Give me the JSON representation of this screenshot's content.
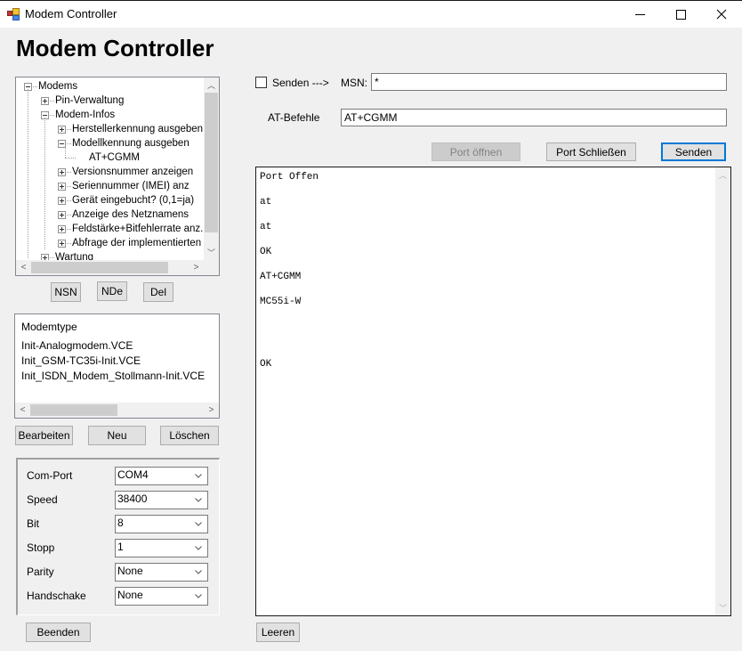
{
  "window": {
    "title": "Modem Controller",
    "icon": "app-window-icon",
    "controls": {
      "minimize": "minimize-icon",
      "maximize": "maximize-icon",
      "close": "close-icon"
    }
  },
  "header": {
    "title": "Modem Controller"
  },
  "tree": {
    "nodes": [
      {
        "label": "Modems",
        "level": 0,
        "expander": "minus"
      },
      {
        "label": "Pin-Verwaltung",
        "level": 1,
        "expander": "plus"
      },
      {
        "label": "Modem-Infos",
        "level": 1,
        "expander": "minus"
      },
      {
        "label": "Herstellerkennung ausgeben",
        "level": 2,
        "expander": "plus"
      },
      {
        "label": "Modellkennung ausgeben",
        "level": 2,
        "expander": "minus"
      },
      {
        "label": "AT+CGMM",
        "level": 3,
        "expander": "none"
      },
      {
        "label": "Versionsnummer anzeigen",
        "level": 2,
        "expander": "plus"
      },
      {
        "label": "Seriennummer (IMEI) anz",
        "level": 2,
        "expander": "plus"
      },
      {
        "label": "Gerät eingebucht? (0,1=ja)",
        "level": 2,
        "expander": "plus"
      },
      {
        "label": "Anzeige des Netznamens",
        "level": 2,
        "expander": "plus"
      },
      {
        "label": "Feldstärke+Bitfehlerrate anz.",
        "level": 2,
        "expander": "plus"
      },
      {
        "label": "Abfrage der implementierten Fe",
        "level": 2,
        "expander": "plus"
      },
      {
        "label": "Wartung",
        "level": 1,
        "expander": "plus"
      }
    ]
  },
  "tree_buttons": {
    "nsn": "NSN",
    "nde": "NDe",
    "del": "Del"
  },
  "modemtype": {
    "header": "Modemtype",
    "items": [
      "Init-Analogmodem.VCE",
      "Init_GSM-TC35i-Init.VCE",
      "Init_ISDN_Modem_Stollmann-Init.VCE"
    ]
  },
  "modemtype_buttons": {
    "edit": "Bearbeiten",
    "new": "Neu",
    "delete": "Löschen"
  },
  "port_settings": [
    {
      "label": "Com-Port",
      "value": "COM4"
    },
    {
      "label": "Speed",
      "value": "38400"
    },
    {
      "label": "Bit",
      "value": "8"
    },
    {
      "label": "Stopp",
      "value": "1"
    },
    {
      "label": "Parity",
      "value": "None"
    },
    {
      "label": "Handschake",
      "value": "None"
    }
  ],
  "exit_button": "Beenden",
  "send_panel": {
    "checkbox_label": "Senden --->",
    "checkbox_checked": false,
    "msn_label": "MSN:",
    "msn_value": "*",
    "at_label": "AT-Befehle",
    "at_value": "AT+CGMM",
    "open_port": "Port öffnen",
    "open_port_enabled": false,
    "close_port": "Port Schließen",
    "send": "Senden"
  },
  "output": {
    "lines": [
      "Port Offen",
      "",
      "at",
      "",
      "at",
      "",
      "OK",
      "",
      "AT+CGMM",
      "",
      "MC55i-W",
      "",
      "",
      "",
      "",
      "OK"
    ]
  },
  "clear_button": "Leeren"
}
